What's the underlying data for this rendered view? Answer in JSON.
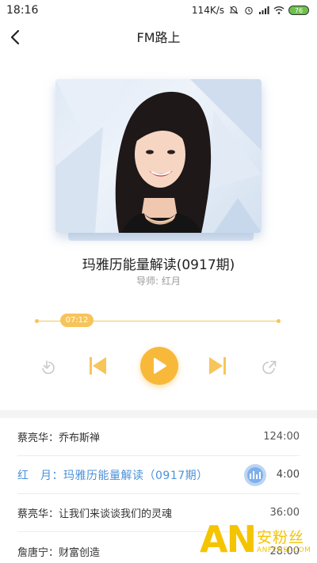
{
  "status_bar": {
    "time": "18:16",
    "net_speed": "114K/s",
    "battery_level": "76",
    "icons": [
      "mute-icon",
      "alarm-icon",
      "signal-icon",
      "wifi-icon",
      "battery-icon"
    ]
  },
  "nav": {
    "title": "FM路上",
    "back_icon": "chevron-left-icon"
  },
  "track": {
    "title": "玛雅历能量解读(0917期)",
    "teacher": "导师: 红月"
  },
  "player": {
    "current_time": "07:12",
    "progress": 0.08,
    "accent": "#f8b93b",
    "controls": [
      "download-icon",
      "prev-icon",
      "play-icon",
      "next-icon",
      "share-icon"
    ]
  },
  "playlist": [
    {
      "title": "蔡亮华：乔布斯禅",
      "duration": "124:00",
      "active": false
    },
    {
      "title": "红　月：玛雅历能量解读（0917期）",
      "duration": "4:00",
      "active": true
    },
    {
      "title": "蔡亮华：让我们来谈谈我们的灵魂",
      "duration": "36:00",
      "active": false
    },
    {
      "title": "詹唐宁：财富创造",
      "duration": "28:00",
      "active": false
    }
  ],
  "watermark": {
    "logo": "AN",
    "cn": "安粉丝",
    "en": "ANFENSI.COM"
  }
}
